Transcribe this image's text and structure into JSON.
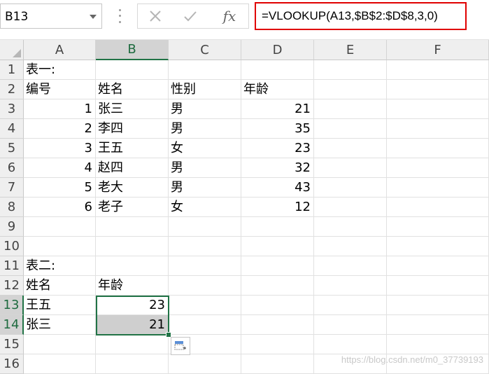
{
  "name_box": {
    "value": "B13"
  },
  "formula_bar": {
    "formula": "=VLOOKUP(A13,$B$2:$D$8,3,0)",
    "cancel_icon": "x-icon",
    "enter_icon": "check-icon",
    "function_label": "fx"
  },
  "columns": [
    "A",
    "B",
    "C",
    "D",
    "E",
    "F"
  ],
  "rows": [
    "1",
    "2",
    "3",
    "4",
    "5",
    "6",
    "7",
    "8",
    "9",
    "10",
    "11",
    "12",
    "13",
    "14",
    "15",
    "16"
  ],
  "cells": {
    "A1": "表一:",
    "A2": "编号",
    "B2": "姓名",
    "C2": "性别",
    "D2": "年龄",
    "A3": "1",
    "B3": "张三",
    "C3": "男",
    "D3": "21",
    "A4": "2",
    "B4": "李四",
    "C4": "男",
    "D4": "35",
    "A5": "3",
    "B5": "王五",
    "C5": "女",
    "D5": "23",
    "A6": "4",
    "B6": "赵四",
    "C6": "男",
    "D6": "32",
    "A7": "5",
    "B7": "老大",
    "C7": "男",
    "D7": "43",
    "A8": "6",
    "B8": "老子",
    "C8": "女",
    "D8": "12",
    "A11": "表二:",
    "A12": "姓名",
    "B12": "年龄",
    "A13": "王五",
    "B13": "23",
    "A14": "张三",
    "B14": "21"
  },
  "selection": {
    "range": "B13:B14",
    "active_cell": "B13"
  },
  "quick_analysis": {
    "icon": "quick-analysis-icon"
  },
  "watermark": "https://blog.csdn.net/m0_37739193",
  "colors": {
    "accent_green": "#217346",
    "formula_highlight": "#e00000",
    "header_bg": "#efefef"
  }
}
